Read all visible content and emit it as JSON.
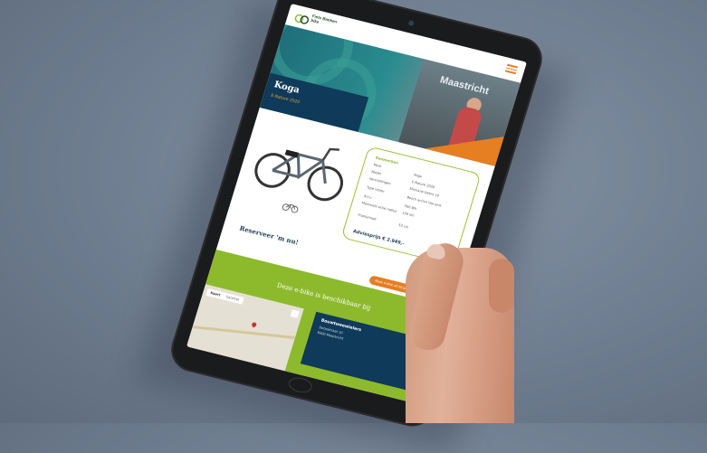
{
  "site": {
    "logo_line1": "Fiets Banken",
    "logo_line2": "bike",
    "menu_icon": "hamburger-icon"
  },
  "hero": {
    "sign_text": "Maastricht",
    "title": "Koga",
    "subtitle": "E-Nature 2020"
  },
  "specs": {
    "heading": "Kenmerken",
    "rows": [
      {
        "k": "Merk",
        "v": "Koga"
      },
      {
        "k": "Model",
        "v": "E-Nature 2020"
      },
      {
        "k": "Versnellingen",
        "v": "Shimano Deore 10"
      },
      {
        "k": "Type motor",
        "v": "Bosch active line plus"
      },
      {
        "k": "Accu",
        "v": "500 Wh"
      },
      {
        "k": "Maximale actie-radius",
        "v": "150 km"
      },
      {
        "k": "Framemaat",
        "v": "53 cm"
      }
    ],
    "price": "Adviesprijs € 2.949,-"
  },
  "content": {
    "reserve": "Reserveer 'm nu!",
    "cta_label": "Maak e-bike uit bij goede proefritten",
    "available_heading": "Deze e-bike is beschikbaar bij"
  },
  "map": {
    "tab_map": "Kaart",
    "tab_satellite": "Satelliet"
  },
  "dealer": {
    "name": "Bouwtweewielers",
    "address1": "Dorpsstraat 10",
    "address2": "6200 Maastricht"
  },
  "colors": {
    "accent_green": "#8dba2c",
    "accent_orange": "#e67e22",
    "navy": "#103a59"
  }
}
